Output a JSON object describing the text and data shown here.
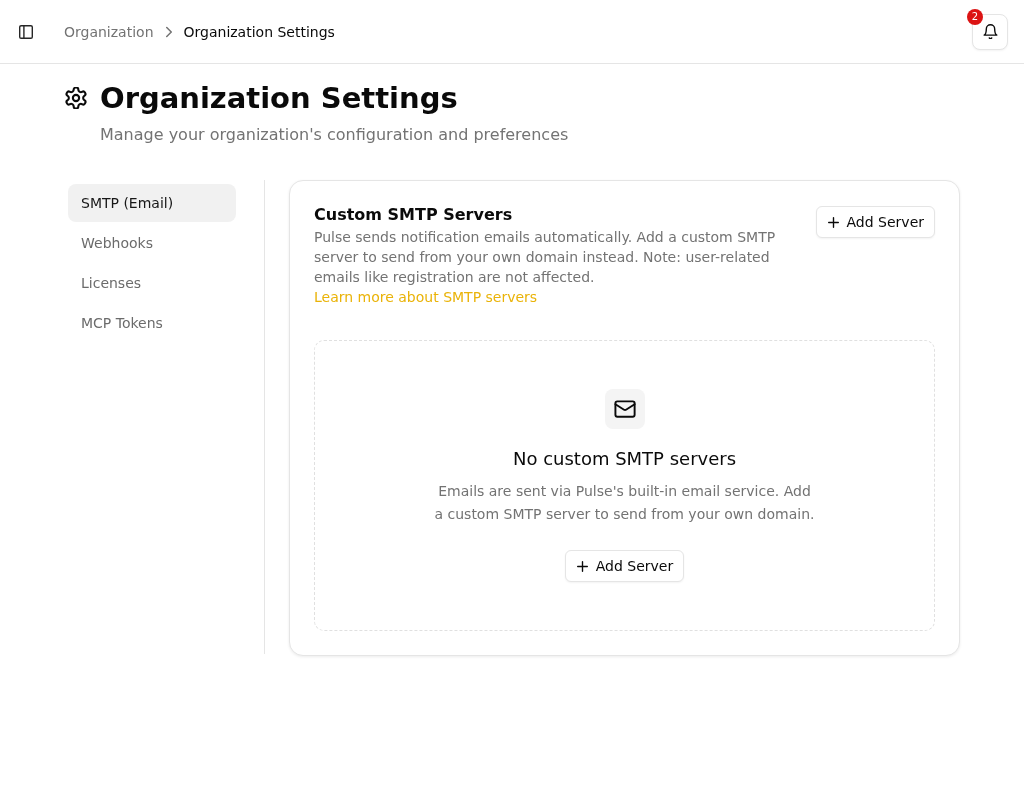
{
  "header": {
    "breadcrumbs": [
      {
        "label": "Organization",
        "current": false
      },
      {
        "label": "Organization Settings",
        "current": true
      }
    ],
    "notifications": {
      "count": "2"
    }
  },
  "page": {
    "title": "Organization Settings",
    "subtitle": "Manage your organization's configuration and preferences"
  },
  "sidebar": {
    "items": [
      {
        "label": "SMTP (Email)",
        "selected": true
      },
      {
        "label": "Webhooks",
        "selected": false
      },
      {
        "label": "Licenses",
        "selected": false
      },
      {
        "label": "MCP Tokens",
        "selected": false
      }
    ]
  },
  "section": {
    "title": "Custom SMTP Servers",
    "description": "Pulse sends notification emails automatically. Add a custom SMTP server to send from your own domain instead. Note: user-related emails like registration are not affected.",
    "link": "Learn more about SMTP servers",
    "button": "Add Server"
  },
  "empty_state": {
    "title": "No custom SMTP servers",
    "description": "Emails are sent via Pulse's built-in email service. Add a custom SMTP server to send from your own domain.",
    "button": "Add Server"
  }
}
